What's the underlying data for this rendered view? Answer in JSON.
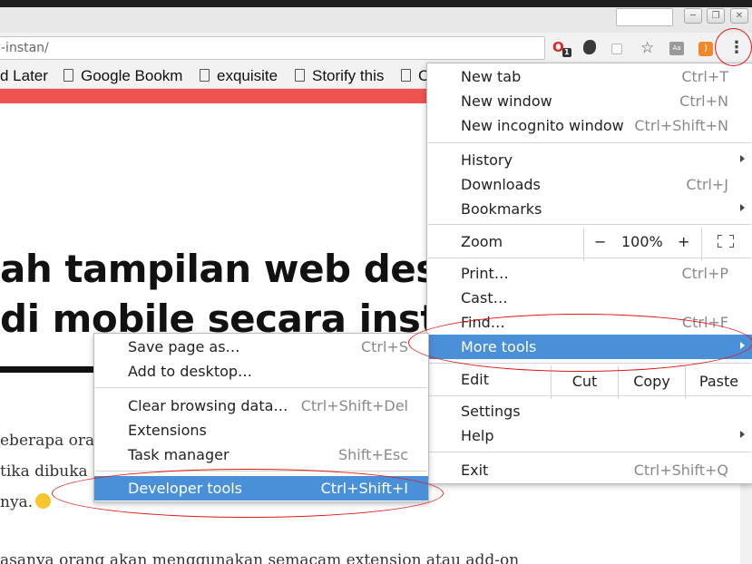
{
  "window": {
    "minimize_glyph": "─",
    "maximize_glyph": "❐",
    "close_glyph": "✕"
  },
  "toolbar": {
    "url": "-instan/",
    "opera_badge": "1",
    "aa_label": "Aa",
    "menu_glyph": "⋮",
    "star_glyph": "☆",
    "rss_glyph": ")"
  },
  "bookmarks": [
    {
      "label": "d Later"
    },
    {
      "label": "Google Bookm"
    },
    {
      "label": "exquisite"
    },
    {
      "label": "Storify this"
    },
    {
      "label": "C"
    }
  ],
  "page": {
    "headline_1": "ah tampilan web des",
    "headline_2": "di mobile secara insta",
    "para_1": "eberapa oran",
    "para_2": "tika dibuka",
    "para_3": "nya.",
    "para_4": "asanya orang akan menggunakan semacam extension atau add-on"
  },
  "main_menu": {
    "new_tab": {
      "label": "New tab",
      "shortcut": "Ctrl+T"
    },
    "new_window": {
      "label": "New window",
      "shortcut": "Ctrl+N"
    },
    "new_incognito": {
      "label": "New incognito window",
      "shortcut": "Ctrl+Shift+N"
    },
    "history": {
      "label": "History"
    },
    "downloads": {
      "label": "Downloads",
      "shortcut": "Ctrl+J"
    },
    "bookmarks": {
      "label": "Bookmarks"
    },
    "zoom": {
      "label": "Zoom",
      "minus": "−",
      "value": "100%",
      "plus": "+"
    },
    "print": {
      "label": "Print…",
      "shortcut": "Ctrl+P"
    },
    "cast": {
      "label": "Cast…"
    },
    "find": {
      "label": "Find…",
      "shortcut": "Ctrl+F"
    },
    "more_tools": {
      "label": "More tools"
    },
    "edit": {
      "label": "Edit",
      "cut": "Cut",
      "copy": "Copy",
      "paste": "Paste"
    },
    "settings": {
      "label": "Settings"
    },
    "help": {
      "label": "Help"
    },
    "exit": {
      "label": "Exit",
      "shortcut": "Ctrl+Shift+Q"
    }
  },
  "sub_menu": {
    "save_page": {
      "label": "Save page as…",
      "shortcut": "Ctrl+S"
    },
    "add_desktop": {
      "label": "Add to desktop…"
    },
    "clear_browsing": {
      "label": "Clear browsing data…",
      "shortcut": "Ctrl+Shift+Del"
    },
    "extensions": {
      "label": "Extensions"
    },
    "task_manager": {
      "label": "Task manager",
      "shortcut": "Shift+Esc"
    },
    "developer_tools": {
      "label": "Developer tools",
      "shortcut": "Ctrl+Shift+I"
    }
  },
  "colors": {
    "menu_highlight": "#4a90d9",
    "page_accent": "#ef5350",
    "annotation": "#e01818"
  }
}
